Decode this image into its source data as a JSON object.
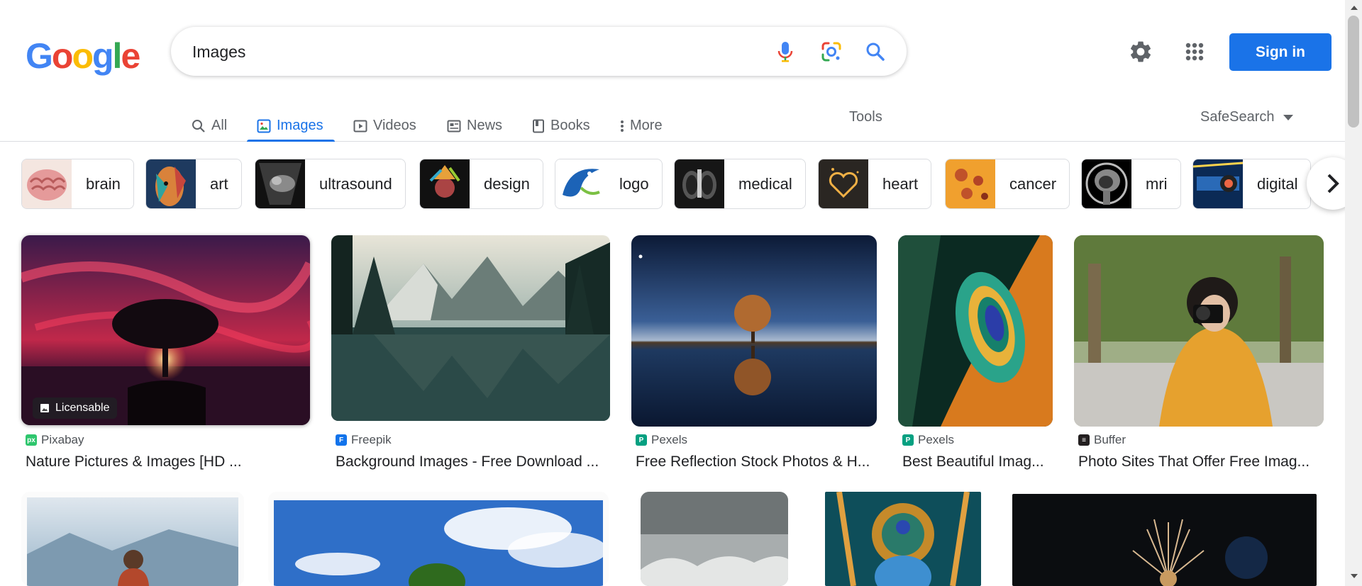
{
  "search": {
    "query": "Images"
  },
  "header": {
    "sign_in_label": "Sign in",
    "logo_letters": [
      "G",
      "o",
      "o",
      "g",
      "l",
      "e"
    ],
    "logo_colors": [
      "#4285F4",
      "#EA4335",
      "#FBBC05",
      "#4285F4",
      "#34A853",
      "#EA4335"
    ]
  },
  "tabs": [
    {
      "label": "All",
      "icon": "search-icon",
      "active": false
    },
    {
      "label": "Images",
      "icon": "image-icon",
      "active": true
    },
    {
      "label": "Videos",
      "icon": "play-icon",
      "active": false
    },
    {
      "label": "News",
      "icon": "news-icon",
      "active": false
    },
    {
      "label": "Books",
      "icon": "book-icon",
      "active": false
    },
    {
      "label": "More",
      "icon": "more-vert-icon",
      "active": false
    }
  ],
  "toolbar": {
    "tools_label": "Tools",
    "safesearch_label": "SafeSearch"
  },
  "chips": [
    {
      "label": "brain"
    },
    {
      "label": "art"
    },
    {
      "label": "ultrasound"
    },
    {
      "label": "design"
    },
    {
      "label": "logo"
    },
    {
      "label": "medical"
    },
    {
      "label": "heart"
    },
    {
      "label": "cancer"
    },
    {
      "label": "mri"
    },
    {
      "label": "digital"
    }
  ],
  "results": [
    {
      "source": "Pixabay",
      "title": "Nature Pictures & Images [HD ...",
      "badge": "Licensable",
      "favicon_color": "#2ec66d"
    },
    {
      "source": "Freepik",
      "title": "Background Images - Free Download ...",
      "favicon_color": "#1273eb"
    },
    {
      "source": "Pexels",
      "title": "Free Reflection Stock Photos & H...",
      "favicon_color": "#05a081"
    },
    {
      "source": "Pexels",
      "title": "Best Beautiful Imag...",
      "favicon_color": "#05a081"
    },
    {
      "source": "Buffer",
      "title": "Photo Sites That Offer Free Imag...",
      "favicon_color": "#231f20"
    }
  ],
  "colors": {
    "accent": "#1a73e8",
    "text": "#202124",
    "secondary": "#5f6368",
    "border": "#dadce0"
  }
}
